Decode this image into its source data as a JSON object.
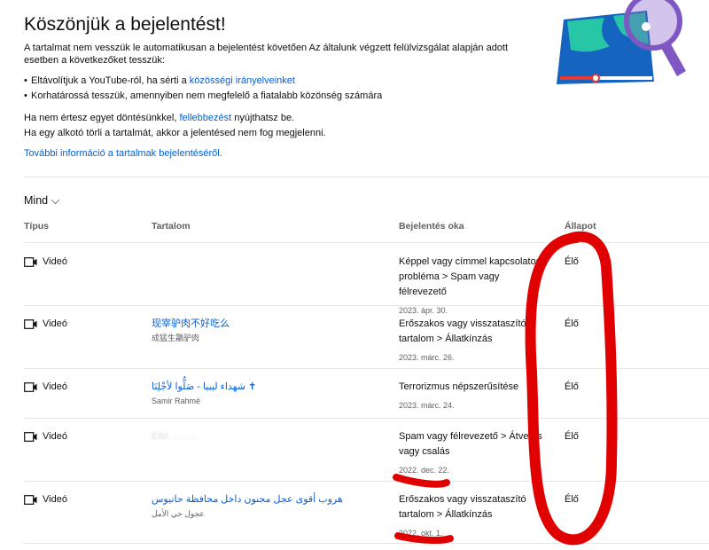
{
  "header": {
    "title": "Köszönjük a bejelentést!",
    "intro": "A tartalmat nem vesszük le automatikusan a bejelentést követően Az általunk végzett felülvizsgálat alapján adott esetben a következőket tesszük:",
    "bullet1_prefix": "Eltávolítjuk a YouTube-ról, ha sérti a ",
    "bullet1_link": "közösségi irányelveinket",
    "bullet2": "Korhatárossá tesszük, amennyiben nem megfelelő a fiatalabb közönség számára",
    "appeal_prefix": "Ha nem értesz egyet döntésünkkel, ",
    "appeal_link": "fellebbezést",
    "appeal_suffix": " nyújthatsz be.",
    "creator_note": "Ha egy alkotó törli a tartalmát, akkor a jelentésed nem fog megjelenni.",
    "more_link": "További információ a tartalmak bejelentéséről."
  },
  "filter": {
    "label": "Mind"
  },
  "columns": {
    "type": "Típus",
    "content": "Tartalom",
    "reason": "Bejelentés oka",
    "status": "Állapot"
  },
  "rows": [
    {
      "type": "Videó",
      "title": "",
      "channel": "",
      "reason": "Képpel vagy címmel kapcsolatos probléma > Spam vagy félrevezető",
      "date": "2023. ápr. 30.",
      "status": "Élő"
    },
    {
      "type": "Videó",
      "title": "现宰驴肉不好吃么",
      "channel": "成猛生鸘驴肉",
      "reason": "Erőszakos vagy visszataszító tartalom > Állatkínzás",
      "date": "2023. márc. 26.",
      "status": "Élő"
    },
    {
      "type": "Videó",
      "title": "شهداء ليبيا - صَلُّوا لأجْلِنَا ✝",
      "channel": "Samir Rahmé",
      "reason": "Terrorizmus népszerűsítése",
      "date": "2023. márc. 24.",
      "status": "Élő"
    },
    {
      "type": "Videó",
      "title": "Elbl. ... .....",
      "channel": "",
      "reason": "Spam vagy félrevezető > Átverés vagy csalás",
      "date": "2022. dec. 22.",
      "status": "Élő"
    },
    {
      "type": "Videó",
      "title": "هروب أقوى عجل مجنون داخل محافظة حانيوس",
      "channel": "عجول حي الأمل",
      "reason": "Erőszakos vagy visszataszító tartalom > Állatkínzás",
      "date": "2022. okt. 1.",
      "status": "Élő"
    }
  ],
  "colors": {
    "link": "#065fd4",
    "annotation": "#e00000"
  }
}
